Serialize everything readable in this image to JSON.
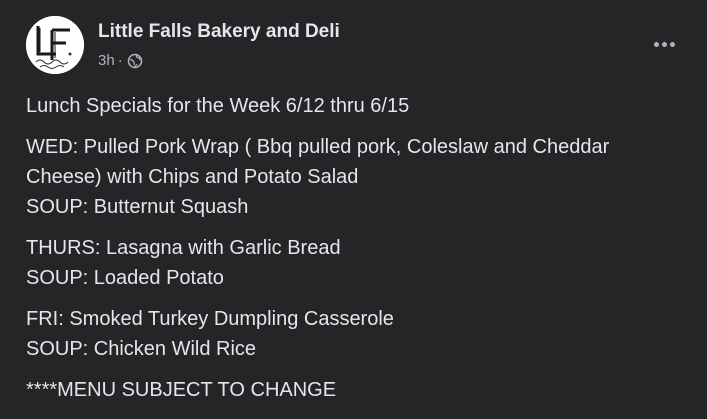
{
  "post": {
    "author": "Little Falls Bakery and Deli",
    "time": "3h",
    "separator": "·",
    "privacy_icon": "globe-icon",
    "more_icon": "more-options-icon",
    "avatar": {
      "logo_initials": "LF",
      "logo_script": "Bakery & Deli",
      "logo_town": "Little Falls"
    },
    "paragraphs": [
      {
        "lines": [
          "Lunch Specials for the Week 6/12 thru 6/15"
        ]
      },
      {
        "lines": [
          "WED: Pulled Pork Wrap ( Bbq pulled pork, Coleslaw and Cheddar",
          "Cheese) with Chips and Potato Salad",
          "SOUP: Butternut Squash"
        ]
      },
      {
        "lines": [
          "THURS: Lasagna with Garlic Bread",
          "SOUP: Loaded Potato"
        ]
      },
      {
        "lines": [
          "FRI: Smoked Turkey Dumpling Casserole",
          "SOUP: Chicken Wild Rice"
        ]
      },
      {
        "lines": [
          "****MENU SUBJECT TO CHANGE"
        ]
      }
    ]
  },
  "colors": {
    "background": "#242526",
    "primary_text": "#e4e6eb",
    "secondary_text": "#b0b3b8",
    "avatar_bg": "#ffffff"
  }
}
